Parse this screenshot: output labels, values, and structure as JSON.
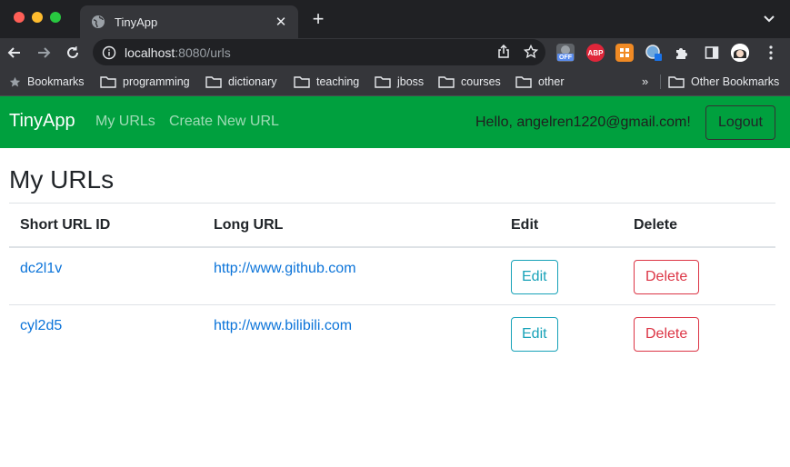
{
  "browser": {
    "tab_title": "TinyApp",
    "url_host": "localhost",
    "url_rest": ":8080/urls",
    "extensions": {
      "off_badge": "OFF",
      "abp_badge": "ABP"
    },
    "bookmarks": [
      {
        "label": "Bookmarks"
      },
      {
        "label": "programming"
      },
      {
        "label": "dictionary"
      },
      {
        "label": "teaching"
      },
      {
        "label": "jboss"
      },
      {
        "label": "courses"
      },
      {
        "label": "other"
      }
    ],
    "overflow": "»",
    "other_bookmarks": "Other Bookmarks"
  },
  "navbar": {
    "brand": "TinyApp",
    "links": [
      "My URLs",
      "Create New URL"
    ],
    "greeting": "Hello, angelren1220@gmail.com!",
    "logout": "Logout"
  },
  "main": {
    "title": "My URLs",
    "columns": [
      "Short URL ID",
      "Long URL",
      "Edit",
      "Delete"
    ],
    "rows": [
      {
        "short_id": "dc2l1v",
        "long_url": "http://www.github.com",
        "edit": "Edit",
        "delete": "Delete"
      },
      {
        "short_id": "cyl2d5",
        "long_url": "http://www.bilibili.com",
        "edit": "Edit",
        "delete": "Delete"
      }
    ]
  },
  "colors": {
    "navbar_bg": "#00a03e",
    "link": "#0a73d9",
    "edit_btn": "#17a2b8",
    "delete_btn": "#dc3545"
  }
}
